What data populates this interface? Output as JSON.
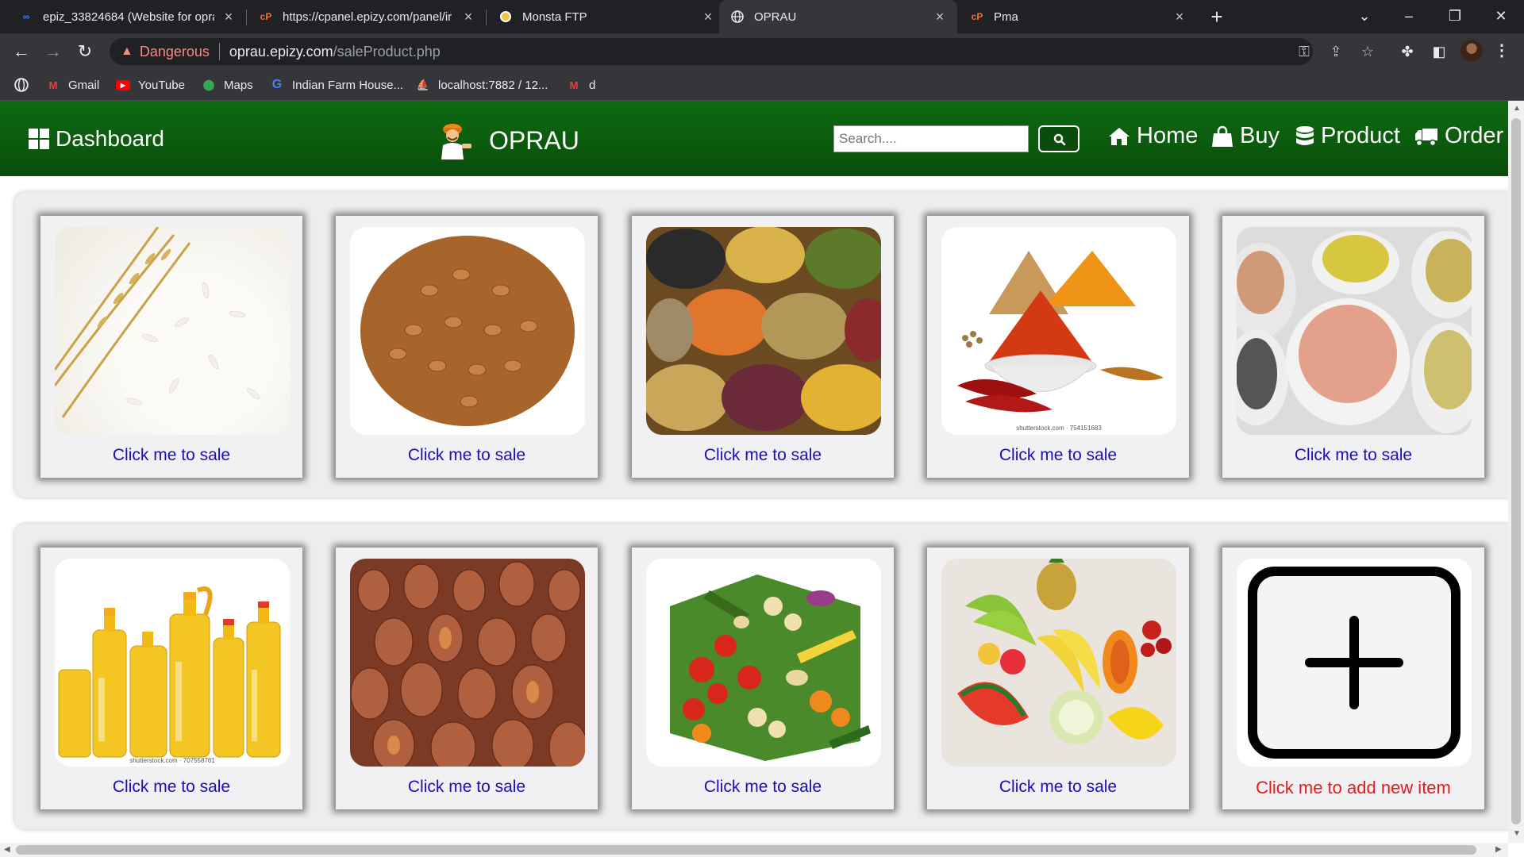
{
  "browser": {
    "tabs": [
      {
        "title": "epiz_33824684 (Website for opra"
      },
      {
        "title": "https://cpanel.epizy.com/panel/ir"
      },
      {
        "title": "Monsta FTP"
      },
      {
        "title": "OPRAU"
      },
      {
        "title": "Pma"
      }
    ],
    "address": {
      "security_label": "Dangerous",
      "host": "oprau.epizy.com",
      "path": "/saleProduct.php"
    },
    "bookmarks": [
      {
        "label": "Gmail"
      },
      {
        "label": "YouTube"
      },
      {
        "label": "Maps"
      },
      {
        "label": "Indian Farm House..."
      },
      {
        "label": "localhost:7882 / 12..."
      },
      {
        "label": "d"
      }
    ]
  },
  "header": {
    "dashboard_label": "Dashboard",
    "brand": "OPRAU",
    "search_placeholder": "Search....",
    "nav": [
      {
        "label": "Home",
        "icon": "home-icon"
      },
      {
        "label": "Buy",
        "icon": "shopping-bag-icon"
      },
      {
        "label": "Product",
        "icon": "database-icon"
      },
      {
        "label": "Order",
        "icon": "truck-icon"
      }
    ]
  },
  "products": {
    "row1": [
      {
        "image": "rice",
        "label": "Click me to sale"
      },
      {
        "image": "wheat",
        "label": "Click me to sale"
      },
      {
        "image": "pulses",
        "label": "Click me to sale"
      },
      {
        "image": "spices",
        "label": "Click me to sale",
        "watermark": "shutterstock.com · 754151683"
      },
      {
        "image": "grain-sacks",
        "label": "Click me to sale"
      }
    ],
    "row2": [
      {
        "image": "cooking-oil",
        "label": "Click me to sale",
        "watermark": "shutterstock.com · 707558761"
      },
      {
        "image": "clay-pots",
        "label": "Click me to sale"
      },
      {
        "image": "vegetables",
        "label": "Click me to sale"
      },
      {
        "image": "fruits",
        "label": "Click me to sale"
      },
      {
        "image": "add-new",
        "label": "Click me to add new item"
      }
    ]
  },
  "colors": {
    "header_green": "#0b5a0d",
    "link_blue": "#1a0dbf",
    "add_red": "#e31b1b"
  }
}
